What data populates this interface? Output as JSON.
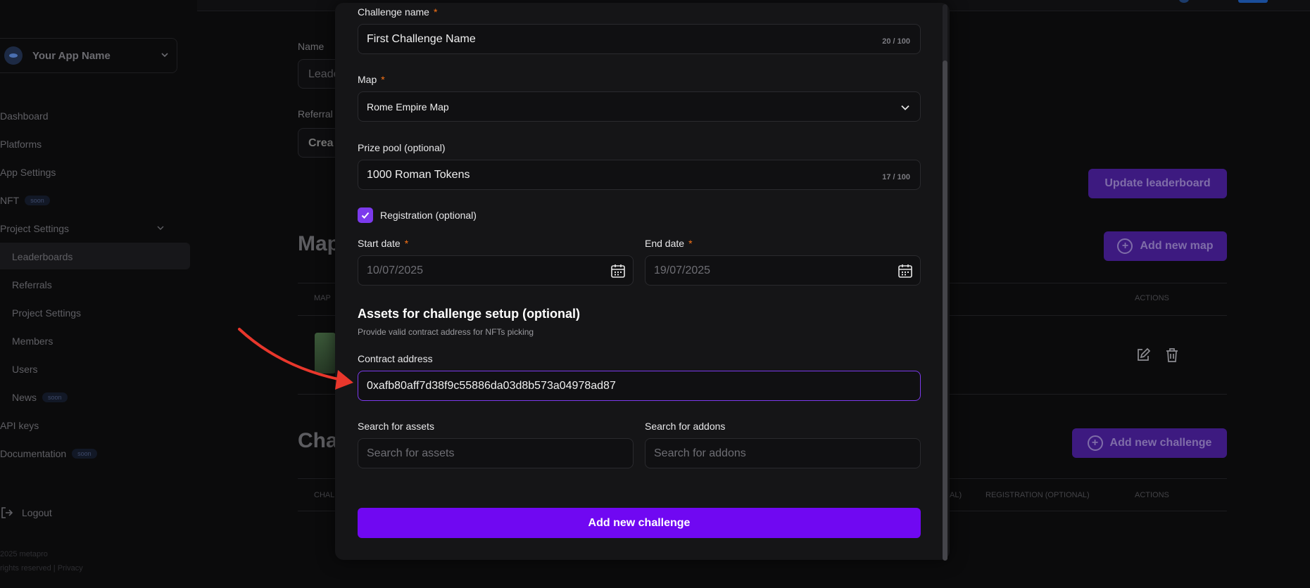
{
  "sidebar": {
    "app_name": "Your App Name",
    "nav": {
      "dashboard": "Dashboard",
      "platforms": "Platforms",
      "app_settings": "App Settings",
      "nft": "NFT",
      "project_settings": "Project Settings",
      "leaderboards": "Leaderboards",
      "referrals": "Referrals",
      "project_settings_sub": "Project Settings",
      "members": "Members",
      "users": "Users",
      "news": "News",
      "api_keys": "API keys",
      "documentation": "Documentation"
    },
    "soon_badge": "soon",
    "logout": "Logout",
    "footer_copyright": "2025 metapro",
    "footer_rights": "rights reserved | Privacy"
  },
  "background": {
    "name_label": "Name",
    "name_value": "Leade",
    "referral_label": "Referral",
    "create_button": "Crea",
    "update_leaderboard": "Update leaderboard",
    "maps_title": "Map",
    "add_new_map": "Add new map",
    "map_col": "MAP",
    "actions_col": "ACTIONS",
    "challenges_title": "Cha",
    "add_new_challenge": "Add new challenge",
    "chal_col": "CHAL",
    "al_col": "AL)",
    "registration_col": "REGISTRATION (OPTIONAL)",
    "actions_col_2": "ACTIONS"
  },
  "modal": {
    "challenge_name": {
      "label": "Challenge name",
      "value": "First Challenge Name",
      "counter": "20 / 100"
    },
    "map": {
      "label": "Map",
      "value": "Rome Empire Map"
    },
    "prize_pool": {
      "label": "Prize pool (optional)",
      "value": "1000 Roman Tokens",
      "counter": "17 / 100"
    },
    "registration": {
      "label": "Registration (optional)",
      "checked": true
    },
    "start_date": {
      "label": "Start date",
      "value": "10/07/2025"
    },
    "end_date": {
      "label": "End date",
      "value": "19/07/2025"
    },
    "assets_title": "Assets for challenge setup (optional)",
    "assets_subtitle": "Provide valid contract address for NFTs picking",
    "contract_address": {
      "label": "Contract address",
      "value": "0xafb80aff7d38f9c55886da03d8b573a04978ad87"
    },
    "search_assets": {
      "label": "Search for assets",
      "placeholder": "Search for assets"
    },
    "search_addons": {
      "label": "Search for addons",
      "placeholder": "Search for addons"
    },
    "required_mark": "*",
    "submit": "Add new challenge"
  },
  "colors": {
    "accent": "#7008f2",
    "checkbox": "#7c3aed",
    "required": "#f97316",
    "annotation_arrow": "#e8372c"
  }
}
